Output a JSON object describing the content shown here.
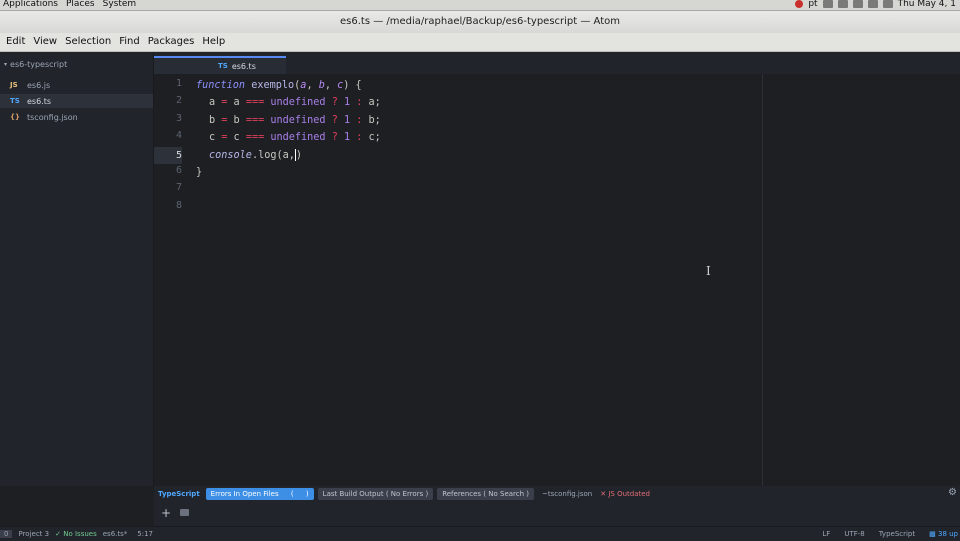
{
  "top_panel": {
    "menus": [
      "Applications",
      "Places",
      "System"
    ],
    "keyboard_layout": "pt",
    "clock": "Thu May  4, 1"
  },
  "window": {
    "title": "es6.ts — /media/raphael/Backup/es6-typescript — Atom"
  },
  "menubar": {
    "items": [
      "Edit",
      "View",
      "Selection",
      "Find",
      "Packages",
      "Help"
    ]
  },
  "tree": {
    "root": "es6-typescript",
    "files": [
      {
        "icon": "JS",
        "name": "es6.js",
        "icon_color": "#e5c07b"
      },
      {
        "icon": "TS",
        "name": "es6.ts",
        "icon_color": "#4fa7ff"
      },
      {
        "icon": "{}",
        "name": "tsconfig.json",
        "icon_color": "#d19a66"
      }
    ]
  },
  "tab": {
    "icon": "TS",
    "label": "es6.ts"
  },
  "editor": {
    "line_numbers": [
      "1",
      "2",
      "3",
      "4",
      "5",
      "6",
      "7",
      "8"
    ],
    "current_line": "5",
    "code": {
      "l1_kw": "function",
      "l1_name": "exemplo",
      "l1_open": "(",
      "l1_a": "a",
      "l1_comma1": ", ",
      "l1_b": "b",
      "l1_comma2": ", ",
      "l1_c": "c",
      "l1_close": ") {",
      "l2_lhs": "a ",
      "l2_eq": "=",
      "l2_mid": " a ",
      "l2_op": "===",
      "l2_und": " undefined ",
      "l2_q": "?",
      "l2_one": " 1 ",
      "l2_colon": ":",
      "l2_end": " a;",
      "l3_lhs": "b ",
      "l3_eq": "=",
      "l3_mid": " b ",
      "l3_op": "===",
      "l3_und": " undefined ",
      "l3_q": "?",
      "l3_one": " 1 ",
      "l3_colon": ":",
      "l3_end": " b;",
      "l4_lhs": "c ",
      "l4_eq": "=",
      "l4_mid": " c ",
      "l4_op": "===",
      "l4_und": " undefined ",
      "l4_q": "?",
      "l4_one": " 1 ",
      "l4_colon": ":",
      "l4_end": " c;",
      "l5_obj": "console",
      "l5_rest": ".log(a,",
      "l5_close": ")",
      "l6": "}"
    }
  },
  "typescript_panel": {
    "name": "TypeScript",
    "errors_button": "Errors In Open Files",
    "errors_open": "(",
    "errors_close": ")",
    "build_button": "Last Build Output ( No Errors )",
    "references_button": "References ( No Search )",
    "tsconfig": "~tsconfig.json",
    "outdated": "JS Outdated"
  },
  "statusbar": {
    "left_indicator": "0",
    "project_tab": "Project",
    "project_count": "3",
    "issues": "No Issues",
    "file": "es6.ts*",
    "cursor_pos": "5:17",
    "line_ending": "LF",
    "encoding": "UTF-8",
    "grammar": "TypeScript",
    "updates": "38 up"
  }
}
